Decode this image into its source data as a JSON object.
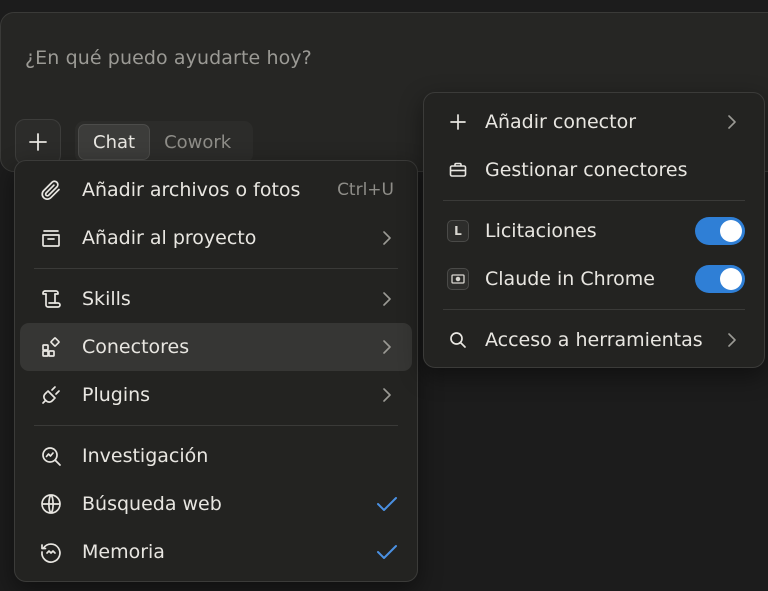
{
  "composer": {
    "placeholder": "¿En qué puedo ayudarte hoy?",
    "modes": [
      {
        "label": "Chat",
        "active": true
      },
      {
        "label": "Cowork",
        "active": false
      }
    ]
  },
  "menu_left": {
    "items": [
      {
        "label": "Añadir archivos o fotos",
        "shortcut": "Ctrl+U",
        "icon": "paperclip-icon"
      },
      {
        "label": "Añadir al proyecto",
        "icon": "project-icon",
        "submenu": true
      },
      {
        "label": "Skills",
        "icon": "scroll-icon",
        "submenu": true
      },
      {
        "label": "Conectores",
        "icon": "blocks-icon",
        "submenu": true,
        "highlighted": true
      },
      {
        "label": "Plugins",
        "icon": "plug-icon",
        "submenu": true
      },
      {
        "label": "Investigación",
        "icon": "research-icon"
      },
      {
        "label": "Búsqueda web",
        "icon": "globe-icon",
        "checked": true
      },
      {
        "label": "Memoria",
        "icon": "memory-icon",
        "checked": true
      }
    ]
  },
  "menu_right": {
    "items": [
      {
        "label": "Añadir conector",
        "icon": "plus-icon",
        "submenu": true
      },
      {
        "label": "Gestionar conectores",
        "icon": "briefcase-icon"
      },
      {
        "label": "Licitaciones",
        "icon_letter": "L",
        "toggle": true
      },
      {
        "label": "Claude in Chrome",
        "icon": "chrome-icon",
        "toggle": true
      },
      {
        "label": "Acceso a herramientas",
        "icon": "search-icon",
        "submenu": true
      }
    ]
  },
  "colors": {
    "accent": "#2f7fd6",
    "check": "#4a90e2",
    "background": "#1c1c1c",
    "menu": "#232321"
  }
}
